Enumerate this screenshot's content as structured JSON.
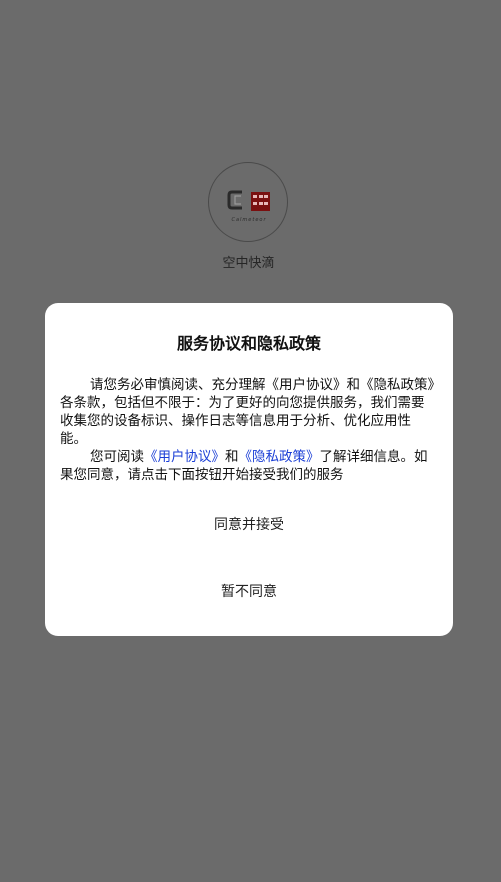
{
  "splash": {
    "app_name": "空中快滴",
    "logo": {
      "icon": "brand-logo",
      "script_text": "Calmeteor",
      "accent_color": "#7a1010"
    }
  },
  "dialog": {
    "title": "服务协议和隐私政策",
    "paragraph1": "请您务必审慎阅读、充分理解《用户协议》和《隐私政策》各条款，包括但不限于：为了更好的向您提供服务，我们需要收集您的设备标识、操作日志等信息用于分析、优化应用性能。",
    "paragraph2": {
      "prefix": "您可阅读",
      "link_user_agreement": "《用户协议》",
      "conjunction": "和",
      "link_privacy_policy": "《隐私政策》",
      "suffix": "了解详细信息。如果您同意，请点击下面按钮开始接受我们的服务"
    },
    "agree_label": "同意并接受",
    "disagree_label": "暂不同意",
    "link_color": "#1a3ed6"
  }
}
